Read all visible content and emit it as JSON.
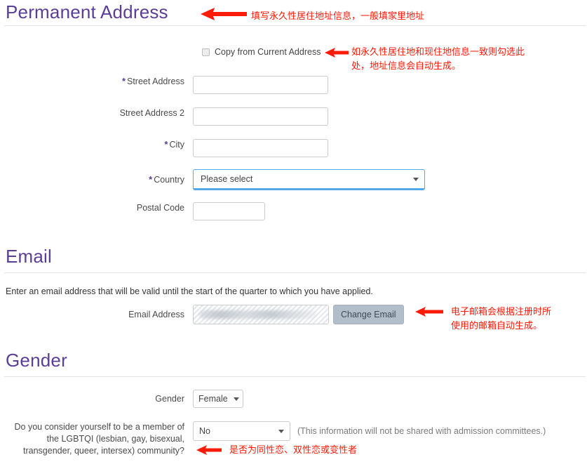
{
  "sections": {
    "permanent_address": {
      "title": "Permanent Address",
      "copy_checkbox_label": "Copy from Current Address",
      "fields": {
        "street_address": {
          "label": "Street Address",
          "required": true,
          "value": ""
        },
        "street_address_2": {
          "label": "Street Address 2",
          "required": false,
          "value": ""
        },
        "city": {
          "label": "City",
          "required": true,
          "value": ""
        },
        "country": {
          "label": "Country",
          "required": true,
          "selected": "Please select"
        },
        "postal_code": {
          "label": "Postal Code",
          "required": false,
          "value": ""
        }
      }
    },
    "email": {
      "title": "Email",
      "intro": "Enter an email address that will be valid until the start of the quarter to which you have applied.",
      "address_label": "Email Address",
      "address_value": "",
      "change_button_label": "Change Email"
    },
    "gender": {
      "title": "Gender",
      "gender_label": "Gender",
      "gender_value": "Female",
      "lgbtqi_question": "Do you consider yourself to be a member of the LGBTQI (lesbian, gay, bisexual, transgender, queer, intersex) community?",
      "lgbtqi_value": "No",
      "lgbtqi_note": "(This information will not be shared with admission committees.)"
    }
  },
  "annotations": {
    "permanent_address": "填写永久性居住地址信息，一般填家里地址",
    "copy_checkbox": "如永久性居住地和现住地信息一致则勾选此\n处，地址信息会自动生成。",
    "email": "电子邮箱会根据注册时所\n使用的邮箱自动生成。",
    "lgbtqi": "是否为同性恋、双性恋或变性者"
  },
  "colors": {
    "heading_purple": "#5c3d97",
    "annotation_red": "#fb1b09",
    "focus_blue": "#52a8e8",
    "button_grey_blue": "#b3becb"
  }
}
